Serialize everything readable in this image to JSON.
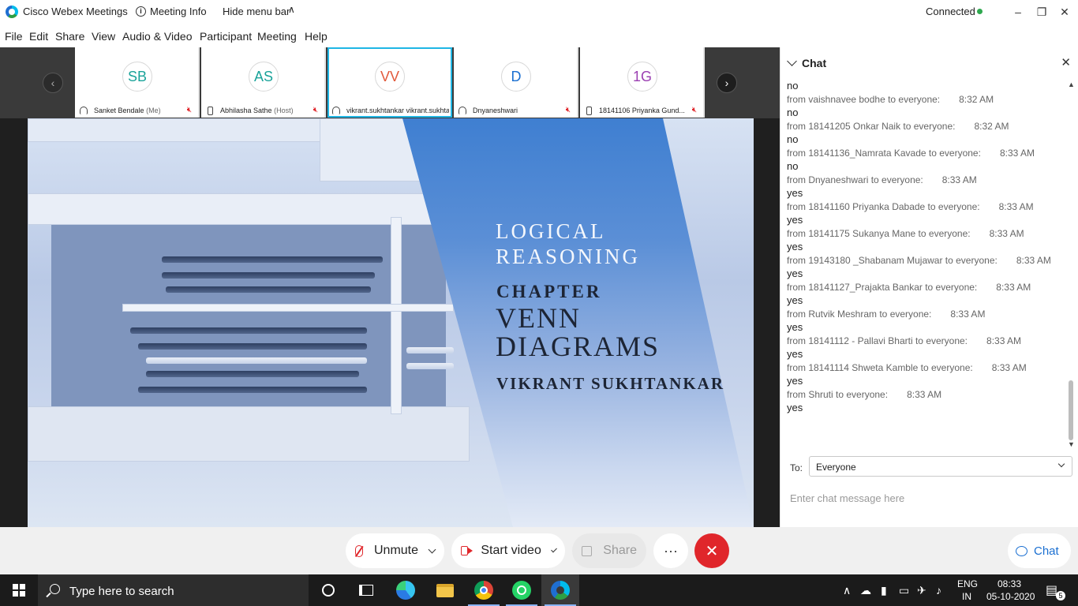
{
  "titlebar": {
    "app_title": "Cisco Webex Meetings",
    "meeting_info": "Meeting Info",
    "hide_menu": "Hide menu bar",
    "status": "Connected"
  },
  "menu": [
    "File",
    "Edit",
    "Share",
    "View",
    "Audio & Video",
    "Participant",
    "Meeting",
    "Help"
  ],
  "participants": [
    {
      "initials": "SB",
      "name": "Sanket Bendale",
      "sub": "(Me)",
      "color": "#1aa39a",
      "device": "audio",
      "muted": true
    },
    {
      "initials": "AS",
      "name": "Abhilasha Sathe",
      "sub": "(Host)",
      "color": "#1aa39a",
      "device": "phone",
      "muted": true
    },
    {
      "initials": "VV",
      "name": "vikrant.sukhtankar vikrant.sukhta...",
      "sub": "",
      "color": "#e25a3c",
      "device": "audio",
      "muted": false
    },
    {
      "initials": "D",
      "name": "Dnyaneshwari",
      "sub": "",
      "color": "#1a6fd1",
      "device": "audio",
      "muted": true
    },
    {
      "initials": "1G",
      "name": "18141106 Priyanka Gund...",
      "sub": "",
      "color": "#9b3fb2",
      "device": "phone",
      "muted": true
    }
  ],
  "slide": {
    "title_line1": "LOGICAL",
    "title_line2": "REASONING",
    "chapter": "CHAPTER",
    "topic_line1": "VENN",
    "topic_line2": "DIAGRAMS",
    "author": "VIKRANT SUKHTANKAR"
  },
  "chat": {
    "title": "Chat",
    "messages": [
      {
        "from": "",
        "time": "",
        "text": "no"
      },
      {
        "from": "from vaishnavee bodhe to everyone:",
        "time": "8:32 AM",
        "text": "no"
      },
      {
        "from": "from 18141205 Onkar Naik to everyone:",
        "time": "8:32 AM",
        "text": "no"
      },
      {
        "from": "from 18141136_Namrata Kavade to everyone:",
        "time": "8:33 AM",
        "text": "no"
      },
      {
        "from": "from Dnyaneshwari to everyone:",
        "time": "8:33 AM",
        "text": "yes"
      },
      {
        "from": "from 18141160 Priyanka Dabade to everyone:",
        "time": "8:33 AM",
        "text": "yes"
      },
      {
        "from": "from 18141175 Sukanya Mane to everyone:",
        "time": "8:33 AM",
        "text": "yes"
      },
      {
        "from": "from 19143180 _Shabanam Mujawar to everyone:",
        "time": "8:33 AM",
        "text": "yes"
      },
      {
        "from": "from 18141127_Prajakta Bankar to everyone:",
        "time": "8:33 AM",
        "text": "yes"
      },
      {
        "from": "from Rutvik Meshram to everyone:",
        "time": "8:33 AM",
        "text": "yes"
      },
      {
        "from": "from 18141112 - Pallavi Bharti to everyone:",
        "time": "8:33 AM",
        "text": "yes"
      },
      {
        "from": "from 18141114 Shweta Kamble to everyone:",
        "time": "8:33 AM",
        "text": "yes"
      },
      {
        "from": "from Shruti to everyone:",
        "time": "8:33 AM",
        "text": "yes"
      }
    ],
    "to_label": "To:",
    "to_value": "Everyone",
    "input_placeholder": "Enter chat message here"
  },
  "controls": {
    "unmute": "Unmute",
    "start_video": "Start video",
    "share": "Share",
    "more": "···",
    "chat": "Chat"
  },
  "taskbar": {
    "search_placeholder": "Type here to search",
    "lang": "ENG",
    "region": "IN",
    "time": "08:33",
    "date": "05-10-2020",
    "notifications": "5"
  }
}
